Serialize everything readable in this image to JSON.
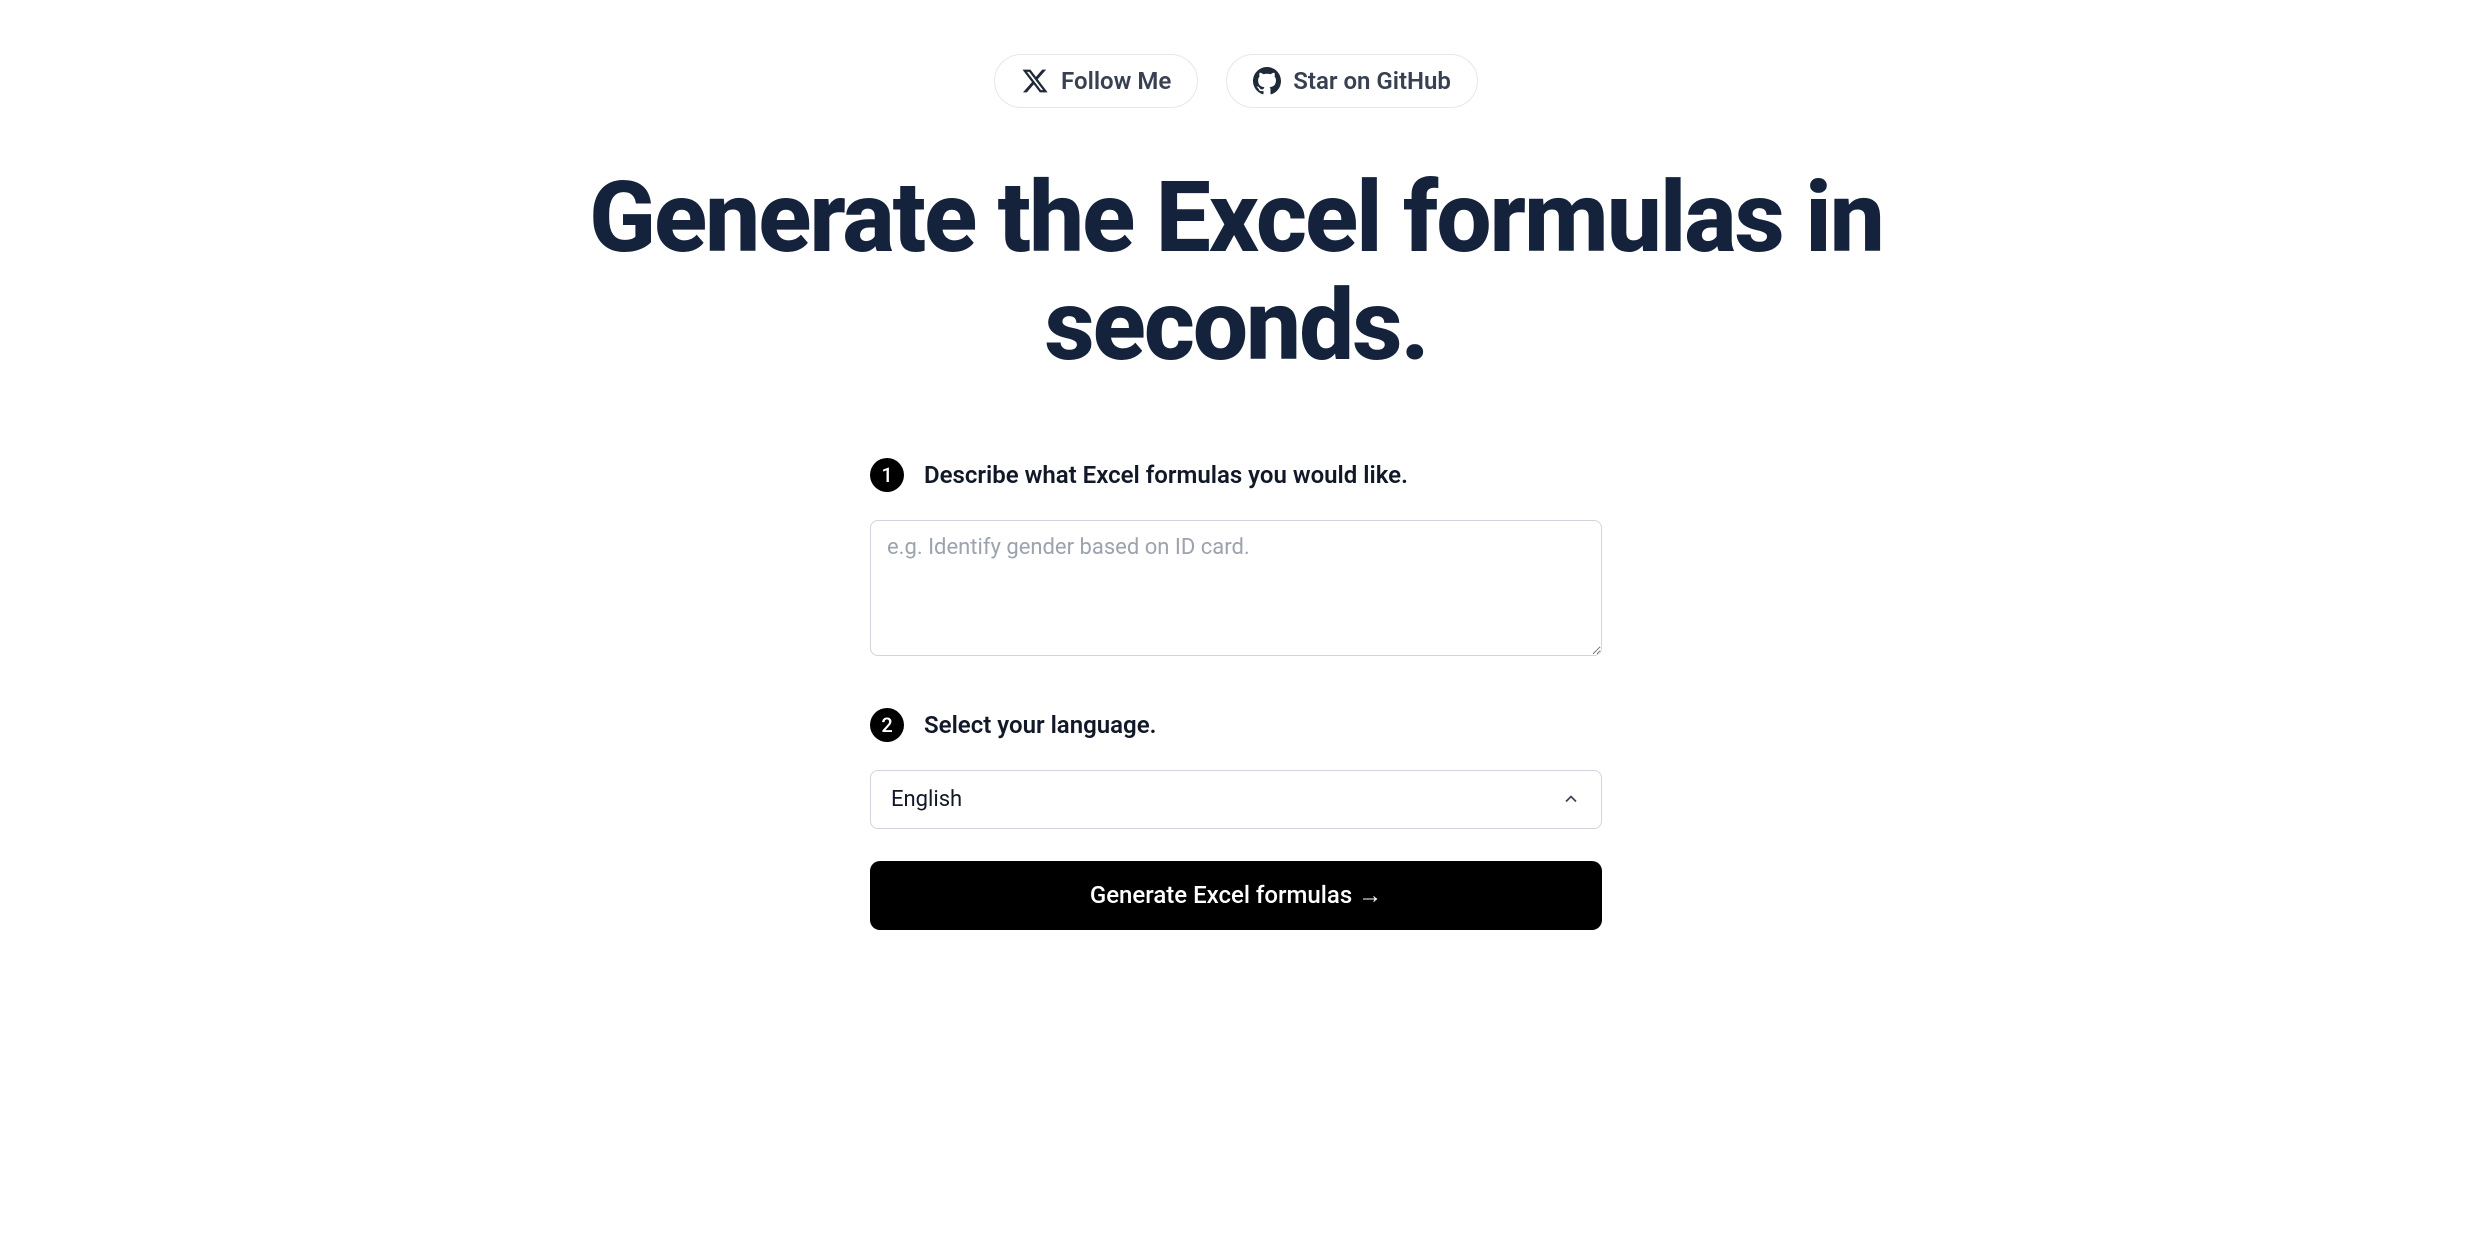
{
  "social": {
    "follow_label": "Follow Me",
    "github_label": "Star on GitHub"
  },
  "title": "Generate the Excel formulas in seconds.",
  "steps": {
    "step1": {
      "number": "1",
      "label": "Describe what Excel formulas you would like.",
      "placeholder": "e.g. Identify gender based on ID card."
    },
    "step2": {
      "number": "2",
      "label": "Select your language.",
      "selected": "English"
    }
  },
  "generate_button": "Generate Excel formulas →"
}
